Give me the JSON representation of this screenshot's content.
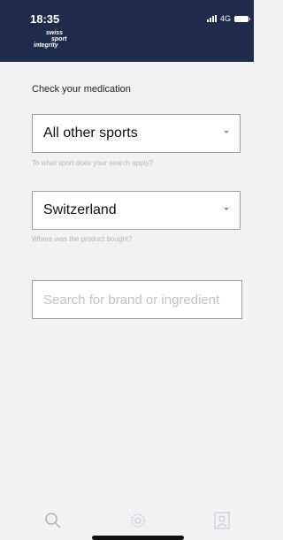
{
  "status_bar": {
    "time": "18:35",
    "network": "4G"
  },
  "logo": {
    "line1": "swiss",
    "line2": "sport",
    "line3": "integrity"
  },
  "main": {
    "title": "Check your medication",
    "sport_select": {
      "value": "All other sports",
      "helper": "To what sport does your search apply?"
    },
    "country_select": {
      "value": "Switzerland",
      "helper": "Where was the product bought?"
    },
    "search": {
      "placeholder": "Search for brand or ingredient",
      "value": ""
    }
  },
  "tabbar": {
    "items": [
      {
        "icon": "search-icon"
      },
      {
        "icon": "gear-icon"
      },
      {
        "icon": "profile-icon"
      }
    ]
  },
  "colors": {
    "header": "#1f2b4a",
    "background": "#f2f2f4",
    "border": "#9a9ca4"
  }
}
